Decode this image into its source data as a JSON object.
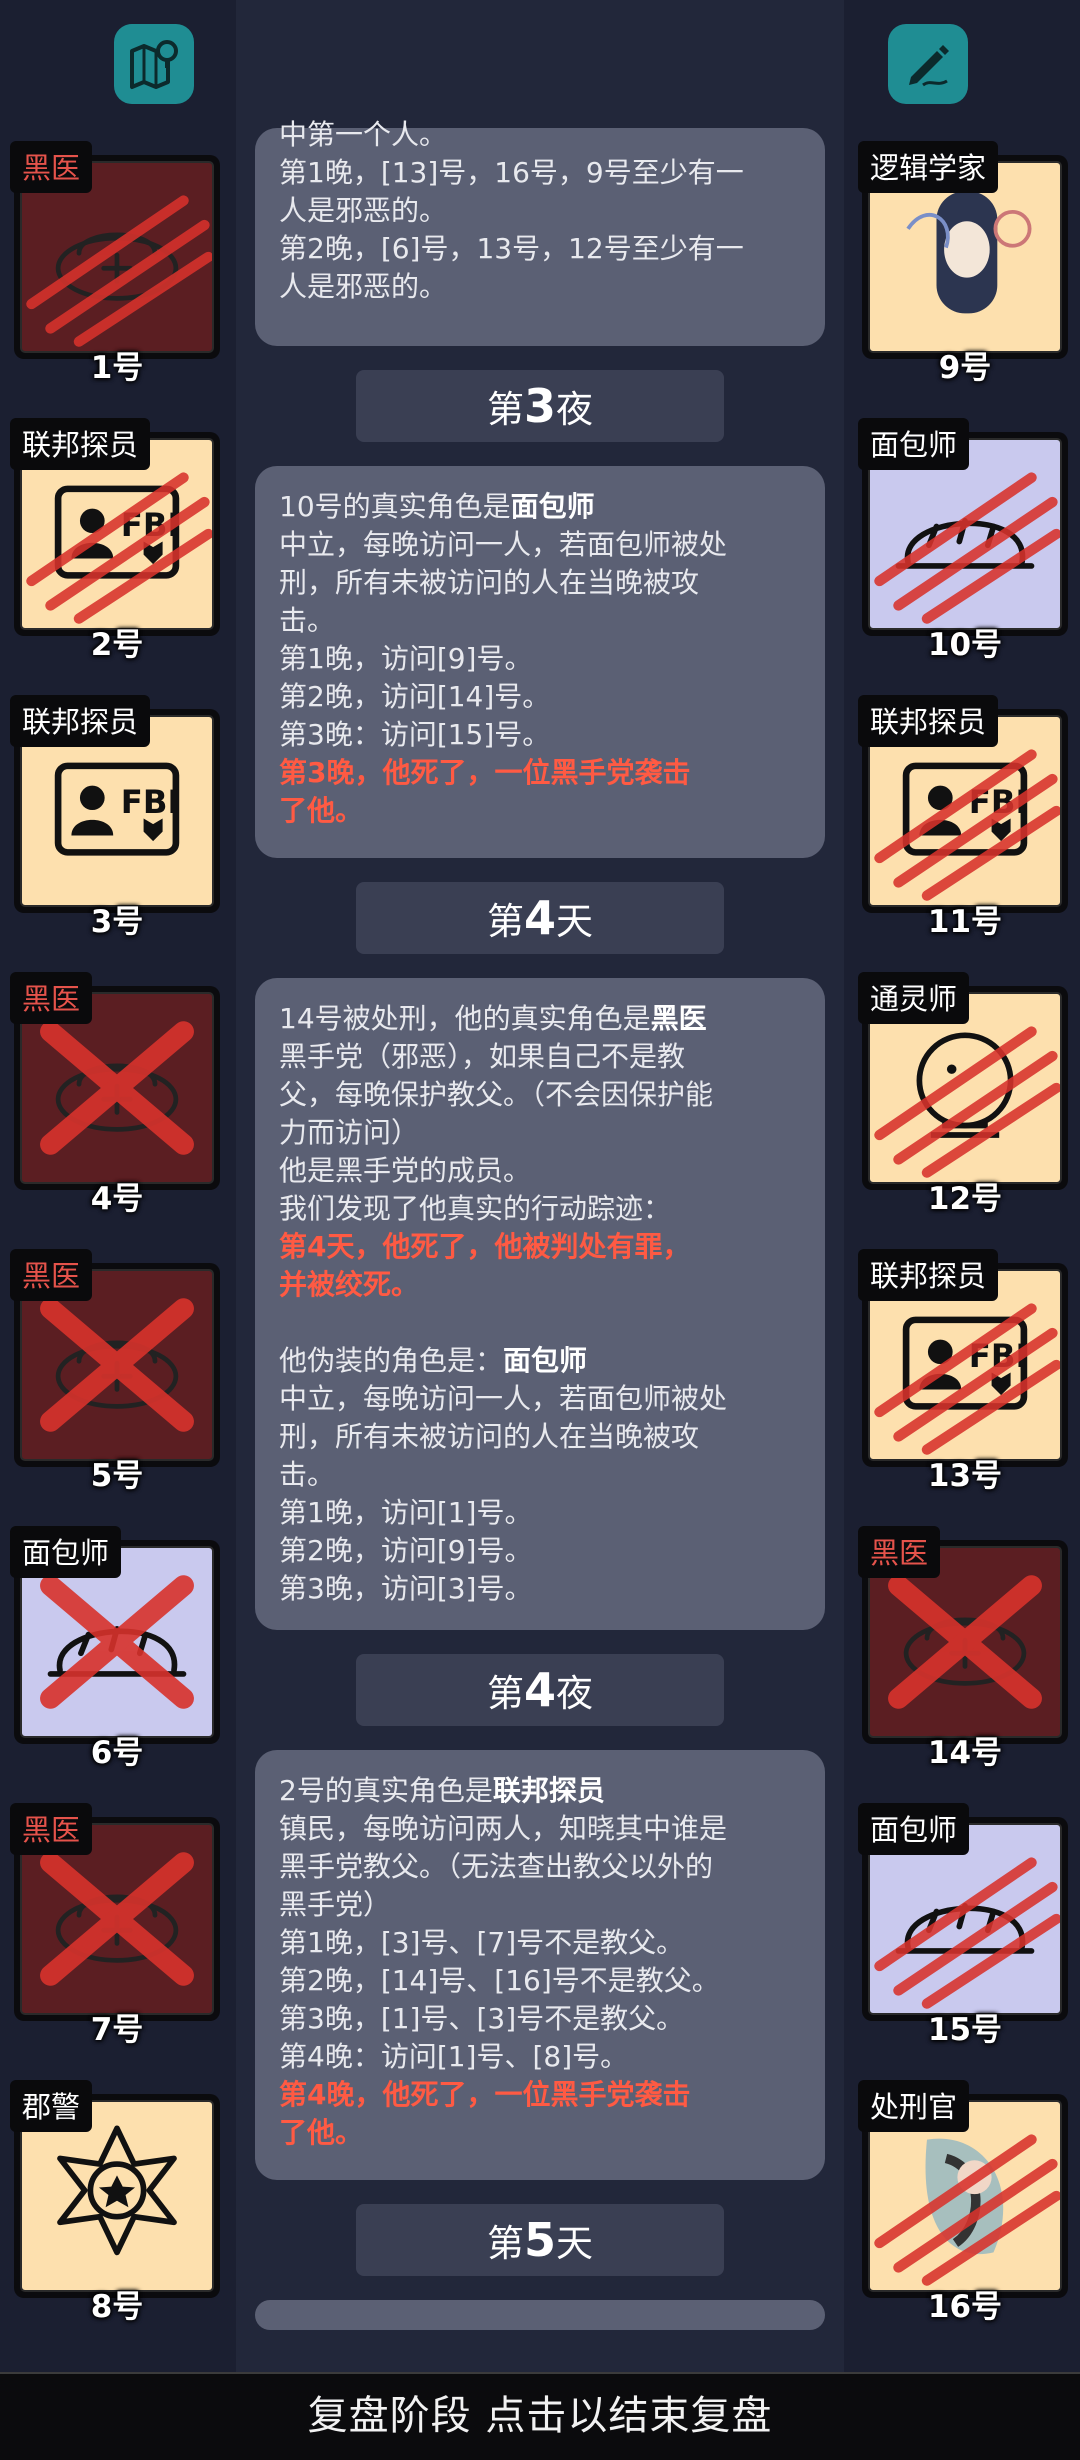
{
  "header": {
    "map_icon": "map-icon",
    "notes_icon": "pencil-icon"
  },
  "left_players": [
    {
      "role": "黑医",
      "number": "1号",
      "type": "doctor",
      "state": "clawed",
      "tag_red": true
    },
    {
      "role": "联邦探员",
      "number": "2号",
      "type": "fbi",
      "state": "clawed",
      "tag_red": false
    },
    {
      "role": "联邦探员",
      "number": "3号",
      "type": "fbi",
      "state": "alive",
      "tag_red": false
    },
    {
      "role": "黑医",
      "number": "4号",
      "type": "doctor",
      "state": "executed",
      "tag_red": true
    },
    {
      "role": "黑医",
      "number": "5号",
      "type": "doctor",
      "state": "executed",
      "tag_red": true
    },
    {
      "role": "面包师",
      "number": "6号",
      "type": "baker",
      "state": "executed",
      "tag_red": false
    },
    {
      "role": "黑医",
      "number": "7号",
      "type": "doctor",
      "state": "executed",
      "tag_red": true
    },
    {
      "role": "郡警",
      "number": "8号",
      "type": "sheriff",
      "state": "alive",
      "tag_red": false
    }
  ],
  "right_players": [
    {
      "role": "逻辑学家",
      "number": "9号",
      "type": "logician",
      "state": "alive",
      "tag_red": false
    },
    {
      "role": "面包师",
      "number": "10号",
      "type": "baker",
      "state": "clawed",
      "tag_red": false
    },
    {
      "role": "联邦探员",
      "number": "11号",
      "type": "fbi",
      "state": "clawed",
      "tag_red": false
    },
    {
      "role": "通灵师",
      "number": "12号",
      "type": "medium",
      "state": "clawed",
      "tag_red": false
    },
    {
      "role": "联邦探员",
      "number": "13号",
      "type": "fbi",
      "state": "clawed",
      "tag_red": false
    },
    {
      "role": "黑医",
      "number": "14号",
      "type": "doctor",
      "state": "executed",
      "tag_red": true
    },
    {
      "role": "面包师",
      "number": "15号",
      "type": "baker",
      "state": "clawed",
      "tag_red": false
    },
    {
      "role": "处刑官",
      "number": "16号",
      "type": "executioner",
      "state": "clawed",
      "tag_red": false
    }
  ],
  "log": {
    "box1": {
      "lines": [
        "中第一个人。",
        "第1晚，[13]号，16号，9号至少有一",
        "人是邪恶的。",
        "第2晚，[6]号，13号，12号至少有一",
        "人是邪恶的。"
      ]
    },
    "phase1": {
      "prefix": "第",
      "num": "3",
      "suffix": "夜"
    },
    "box2": {
      "title_plain": "10号的真实角色是",
      "title_bold": "面包师",
      "lines": [
        "中立，每晚访问一人，若面包师被处",
        "刑，所有未被访问的人在当晚被攻",
        "击。",
        "第1晚，访问[9]号。",
        "第2晚，访问[14]号。",
        "第3晚：访问[15]号。"
      ],
      "red": [
        "第3晚，他死了，一位黑手党袭击",
        "了他。"
      ]
    },
    "phase2": {
      "prefix": "第",
      "num": "4",
      "suffix": "天"
    },
    "box3": {
      "title_plain": "14号被处刑，他的真实角色是",
      "title_bold": "黑医",
      "lines": [
        "黑手党（邪恶），如果自己不是教",
        "父，每晚保护教父。（不会因保护能",
        "力而访问）",
        "他是黑手党的成员。",
        "我们发现了他真实的行动踪迹："
      ],
      "red": [
        "第4天，他死了，他被判处有罪，",
        "并被绞死。"
      ],
      "fake_plain": "他伪装的角色是：",
      "fake_bold": "面包师",
      "fake_lines": [
        "中立，每晚访问一人，若面包师被处",
        "刑，所有未被访问的人在当晚被攻",
        "击。",
        "第1晚，访问[1]号。",
        "第2晚，访问[9]号。",
        "第3晚，访问[3]号。"
      ]
    },
    "phase3": {
      "prefix": "第",
      "num": "4",
      "suffix": "夜"
    },
    "box4": {
      "title_plain": "2号的真实角色是",
      "title_bold": "联邦探员",
      "lines": [
        "镇民，每晚访问两人，知晓其中谁是",
        "黑手党教父。（无法查出教父以外的",
        "黑手党）",
        "第1晚，[3]号、[7]号不是教父。",
        "第2晚，[14]号、[16]号不是教父。",
        "第3晚，[1]号、[3]号不是教父。",
        "第4晚：访问[1]号、[8]号。"
      ],
      "red": [
        "第4晚，他死了，一位黑手党袭击",
        "了他。"
      ]
    },
    "phase4": {
      "prefix": "第",
      "num": "5",
      "suffix": "天"
    }
  },
  "footer": {
    "label": "复盘阶段 点击以结束复盘"
  }
}
